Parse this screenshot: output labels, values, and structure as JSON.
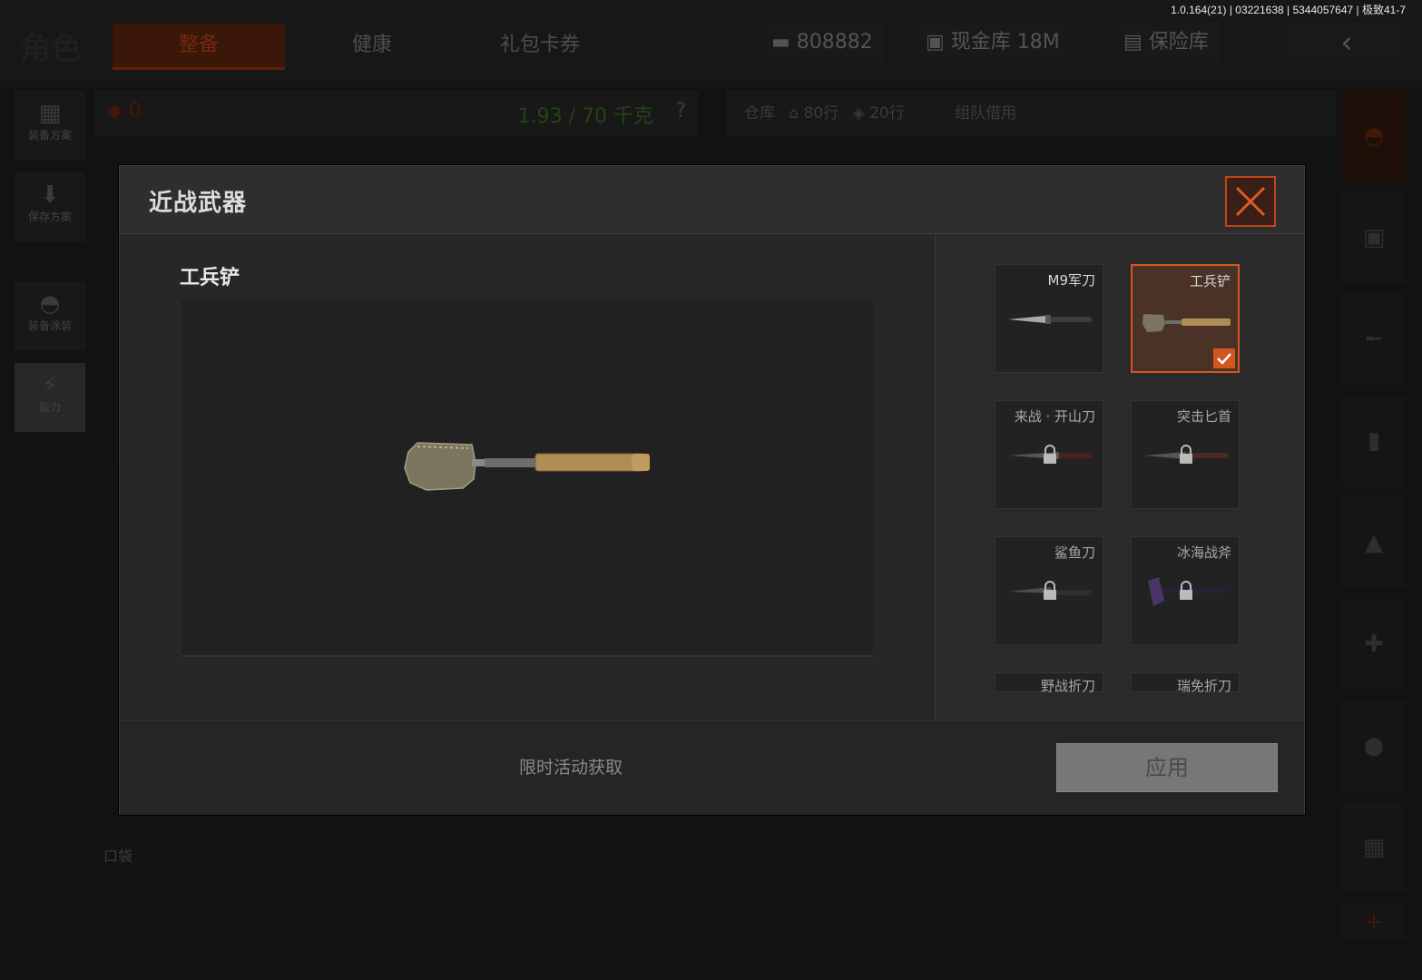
{
  "version_text": "1.0.164(21) | 03221638 | 5344057647 | 极致41-7",
  "background": {
    "role_title": "角色",
    "tabs": [
      "整备",
      "健康",
      "礼包卡券"
    ],
    "currencies": [
      {
        "label": "808882",
        "icon": "cash-icon"
      },
      {
        "label": "现金库 18M",
        "icon": "vault-icon"
      },
      {
        "label": "保险库",
        "icon": "safe-icon"
      }
    ],
    "back_icon": "‹",
    "left_rail": [
      {
        "label": "装备方案",
        "icon": "vest-icon"
      },
      {
        "label": "保存方案",
        "icon": "download-icon"
      },
      {
        "label": "装备涂装",
        "icon": "helmet-icon"
      },
      {
        "label": "能力",
        "icon": "ability-icon"
      }
    ],
    "equip_bar": {
      "count": "0",
      "weight": "1.93 / 70 千克",
      "help": "?"
    },
    "warehouse_bar": {
      "label": "仓库",
      "rows1": "80行",
      "rows2": "20行",
      "team": "组队借用"
    },
    "pocket_label": "口袋",
    "add_icon": "+"
  },
  "modal": {
    "title": "近战武器",
    "selected_name": "工兵铲",
    "footer_text": "限时活动获取",
    "apply_label": "应用",
    "colors": {
      "accent": "#d2561e",
      "panel": "#2b2b2b"
    },
    "weapons": [
      {
        "name": "M9军刀",
        "locked": false,
        "selected": false
      },
      {
        "name": "工兵铲",
        "locked": false,
        "selected": true
      },
      {
        "name": "来战 · 开山刀",
        "locked": true,
        "selected": false
      },
      {
        "name": "突击匕首",
        "locked": true,
        "selected": false
      },
      {
        "name": "鲨鱼刀",
        "locked": true,
        "selected": false
      },
      {
        "name": "冰海战斧",
        "locked": true,
        "selected": false
      },
      {
        "name": "野战折刀",
        "locked": true,
        "selected": false
      },
      {
        "name": "瑞免折刀",
        "locked": true,
        "selected": false
      }
    ]
  }
}
